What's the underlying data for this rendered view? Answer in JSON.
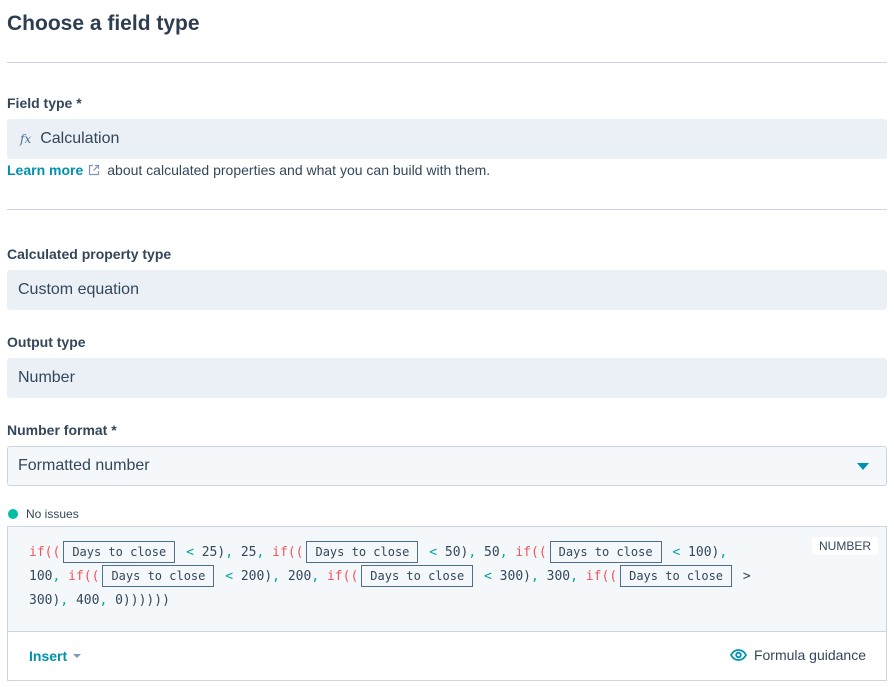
{
  "header": {
    "title": "Choose a field type"
  },
  "field_type": {
    "label": "Field type *",
    "icon": "fx-icon",
    "icon_glyph": "fx",
    "value": "Calculation",
    "helper_link": "Learn more",
    "helper_text": "about calculated properties and what you can build with them."
  },
  "calculated_property_type": {
    "label": "Calculated property type",
    "value": "Custom equation"
  },
  "output_type": {
    "label": "Output type",
    "value": "Number"
  },
  "number_format": {
    "label": "Number format *",
    "value": "Formatted number"
  },
  "validation": {
    "status_text": "No issues",
    "status_color": "#00bda5"
  },
  "formula": {
    "output_badge": "NUMBER",
    "token_label": "Days to close",
    "parts": {
      "if": "if((",
      "t1": "< 25)",
      "c1": ",",
      "v1": " 25",
      "c1b": ",",
      "t2": "< 50)",
      "c2": ",",
      "v2": " 50",
      "c2b": ",",
      "t3": "< 100)",
      "c3": ",",
      "v3": "100",
      "c3b": ",",
      "t4": "< 200)",
      "c4": ",",
      "v4": " 200",
      "c4b": ",",
      "t5": "< 300)",
      "c5": ",",
      "v5": " 300",
      "c5b": ",",
      "t6": ">",
      "v6": "300)",
      "c6": ",",
      "v7": " 400",
      "c7": ",",
      "end": " 0))))))"
    }
  },
  "footer": {
    "insert_label": "Insert",
    "guidance_label": "Formula guidance"
  },
  "colors": {
    "accent": "#0091ae",
    "keyword": "#f2545b",
    "operator": "#00a4a0",
    "field_bg": "#eaf0f6"
  }
}
